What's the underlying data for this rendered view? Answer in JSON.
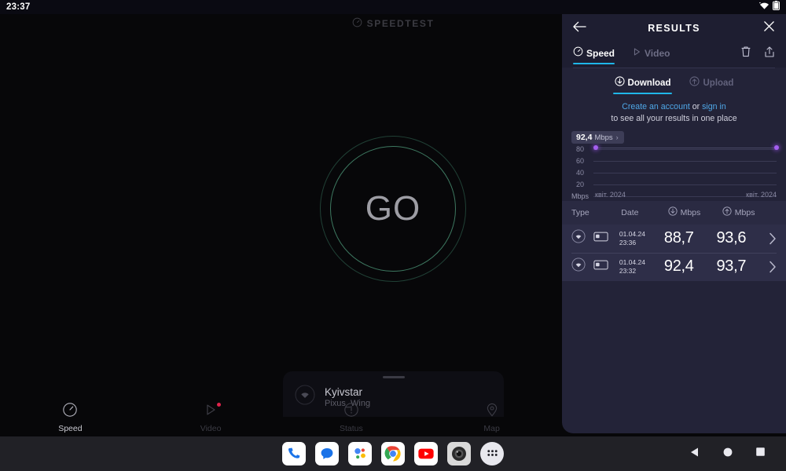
{
  "statusbar": {
    "clock": "23:37",
    "wifi_icon": "wifi-icon",
    "battery_icon": "battery-icon"
  },
  "app": {
    "brand": "SPEEDTEST",
    "brand_icon": "speedometer-icon",
    "go_button": "GO",
    "connection": {
      "isp": "Kyivstar",
      "ssid": "Pixus_Wing",
      "icon": "wifi-circle-icon"
    },
    "bottom_nav": [
      {
        "label": "Speed",
        "icon": "speedometer-icon",
        "active": true,
        "badge": false
      },
      {
        "label": "Video",
        "icon": "play-triangle-icon",
        "active": false,
        "badge": true
      },
      {
        "label": "Status",
        "icon": "exclamation-icon",
        "active": false,
        "badge": false
      },
      {
        "label": "Map",
        "icon": "map-pin-icon",
        "active": false,
        "badge": false
      }
    ]
  },
  "panel": {
    "back_icon": "arrow-left-icon",
    "title": "RESULTS",
    "close_icon": "close-icon",
    "tabs": [
      {
        "label": "Speed",
        "icon": "speedometer-icon",
        "active": true
      },
      {
        "label": "Video",
        "icon": "play-triangle-icon",
        "active": false
      }
    ],
    "actions": [
      {
        "name": "delete-icon"
      },
      {
        "name": "share-icon"
      }
    ],
    "metric_tabs": [
      {
        "label": "Download",
        "icon": "download-arrow-icon",
        "active": true
      },
      {
        "label": "Upload",
        "icon": "upload-arrow-icon",
        "active": false
      }
    ],
    "promo": {
      "create_account": "Create an account",
      "or": " or ",
      "sign_in": "sign in",
      "line2": "to see all your results in one place"
    },
    "table": {
      "headers": {
        "type": "Type",
        "date": "Date",
        "download": "Mbps",
        "upload": "Mbps",
        "download_icon": "download-arrow-icon",
        "upload_icon": "upload-arrow-icon"
      },
      "rows": [
        {
          "conn_icon": "wifi-icon",
          "device_icon": "tablet-icon",
          "date": "01.04.24",
          "time": "23:36",
          "download": "88,7",
          "upload": "93,6",
          "chevron": "chevron-right-icon"
        },
        {
          "conn_icon": "wifi-icon",
          "device_icon": "tablet-icon",
          "date": "01.04.24",
          "time": "23:32",
          "download": "92,4",
          "upload": "93,7",
          "chevron": "chevron-right-icon"
        }
      ]
    }
  },
  "chart_data": {
    "type": "line",
    "title": "",
    "xlabel": "",
    "ylabel": "Mbps",
    "unit_label": "Mbps",
    "ylim": [
      0,
      90
    ],
    "yticks": [
      80,
      60,
      40,
      20
    ],
    "grid": true,
    "x_tick_labels": [
      "квіт. 2024",
      "квіт. 2024"
    ],
    "series": [
      {
        "name": "Download",
        "color": "#a45ff0",
        "x": [
          "01.04.24 23:32",
          "01.04.24 23:36"
        ],
        "values": [
          92.4,
          88.7
        ]
      }
    ],
    "tooltip": {
      "value": "92,4",
      "unit": "Mbps",
      "chevron": "›"
    }
  },
  "taskbar": {
    "apps": [
      {
        "name": "phone-icon"
      },
      {
        "name": "messages-icon"
      },
      {
        "name": "assistant-icon"
      },
      {
        "name": "chrome-icon"
      },
      {
        "name": "youtube-icon"
      },
      {
        "name": "camera-icon"
      },
      {
        "name": "app-drawer-icon"
      }
    ],
    "nav": [
      {
        "name": "back-nav-icon"
      },
      {
        "name": "home-nav-icon"
      },
      {
        "name": "recents-nav-icon"
      }
    ]
  },
  "colors": {
    "panel_bg": "#232338",
    "panel_head_bg": "#1e1e31",
    "accent": "#1fb6e8",
    "link": "#4fa8e8",
    "chart_point": "#a45ff0",
    "go_ring": "#60be96",
    "badge": "#e0234b"
  }
}
